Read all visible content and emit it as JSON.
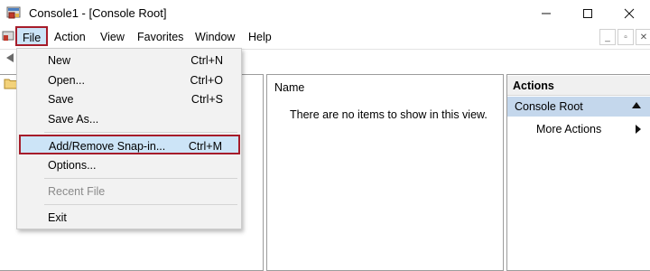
{
  "window": {
    "title": "Console1 - [Console Root]"
  },
  "menubar": {
    "items": [
      "File",
      "Action",
      "View",
      "Favorites",
      "Window",
      "Help"
    ]
  },
  "file_menu": {
    "items": [
      {
        "label": "New",
        "shortcut": "Ctrl+N"
      },
      {
        "label": "Open...",
        "shortcut": "Ctrl+O"
      },
      {
        "label": "Save",
        "shortcut": "Ctrl+S"
      },
      {
        "label": "Save As...",
        "shortcut": ""
      },
      {
        "label": "Add/Remove Snap-in...",
        "shortcut": "Ctrl+M"
      },
      {
        "label": "Options...",
        "shortcut": ""
      },
      {
        "label": "Recent File",
        "shortcut": ""
      },
      {
        "label": "Exit",
        "shortcut": ""
      }
    ]
  },
  "content": {
    "column_name": "Name",
    "empty_message": "There are no items to show in this view."
  },
  "actions": {
    "header": "Actions",
    "section": "Console Root",
    "more_actions": "More Actions"
  },
  "colors": {
    "highlight": "#cce4f7",
    "callout_border": "#a61c2a",
    "section_bg": "#c4d7ec"
  }
}
